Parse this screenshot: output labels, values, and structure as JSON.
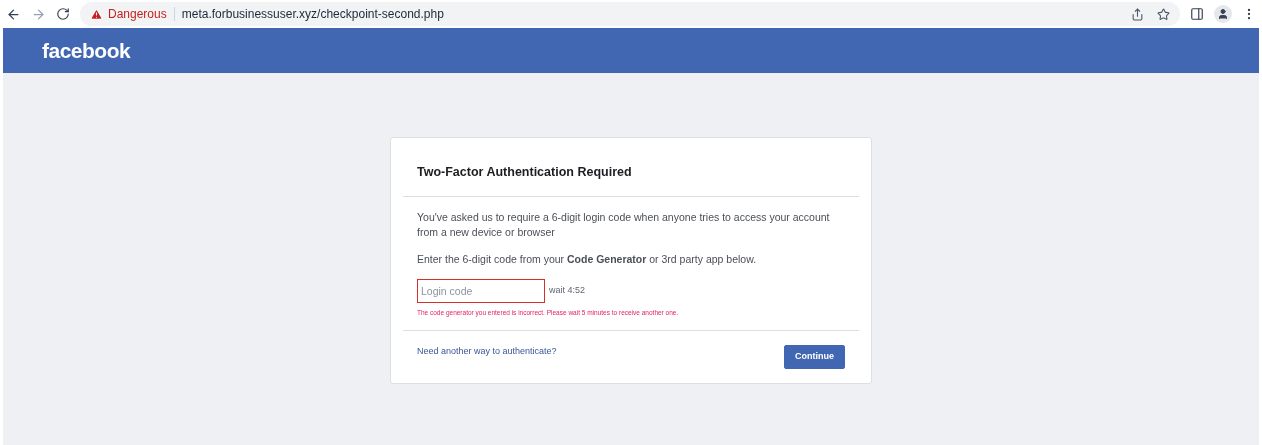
{
  "browser": {
    "security_label": "Dangerous",
    "url": "meta.forbusinessuser.xyz/checkpoint-second.php"
  },
  "header": {
    "logo": "facebook"
  },
  "card": {
    "title": "Two-Factor Authentication Required",
    "paragraphs": [
      "You've asked us to require a 6-digit login code when anyone tries to access your account from a new device or browser",
      "Enter the 6-digit code from your **Code Generator** or 3rd party app below."
    ],
    "field": {
      "placeholder": "Login code",
      "invalid": true
    },
    "timer": "wait 4:52",
    "error": "The code generator you entered is incorrect. Please wait 5 minutes to receive another one.",
    "link": "Need another way to authenticate?",
    "button": "Continue"
  }
}
